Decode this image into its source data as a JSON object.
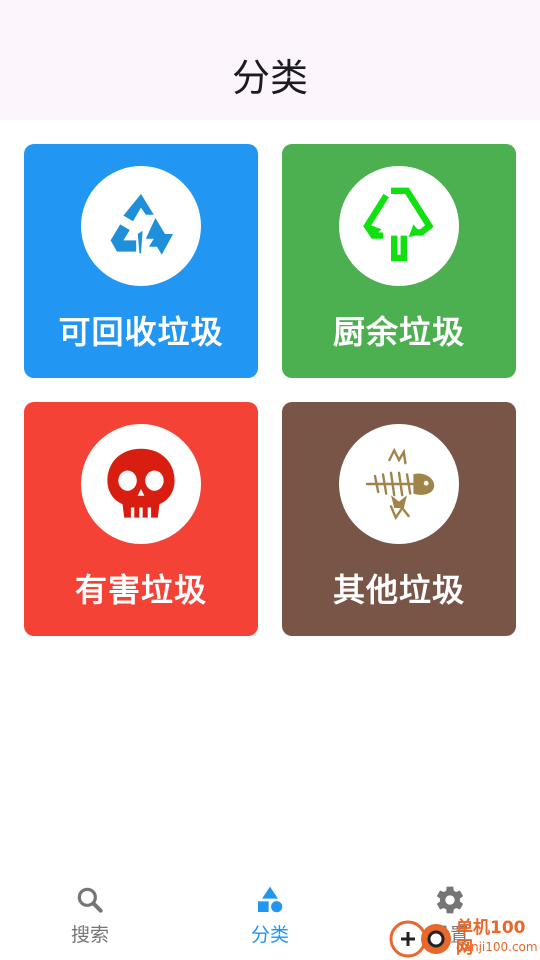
{
  "header": {
    "title": "分类"
  },
  "categories": [
    {
      "label": "可回收垃圾",
      "color": "#2196f3",
      "icon": "recycle-icon",
      "icon_color": "#1e8fd8"
    },
    {
      "label": "厨余垃圾",
      "color": "#4caf50",
      "icon": "kitchen-tree-icon",
      "icon_color": "#10e010"
    },
    {
      "label": "有害垃圾",
      "color": "#f44336",
      "icon": "skull-icon",
      "icon_color": "#d81e10"
    },
    {
      "label": "其他垃圾",
      "color": "#795548",
      "icon": "fish-bone-icon",
      "icon_color": "#a0844a"
    }
  ],
  "bottom_nav": {
    "items": [
      {
        "label": "搜索",
        "icon": "search-icon",
        "active": false
      },
      {
        "label": "分类",
        "icon": "shapes-icon",
        "active": true
      },
      {
        "label": "设置",
        "icon": "gear-icon",
        "active": false
      }
    ],
    "active_color": "#2196f3",
    "inactive_color": "#757575"
  },
  "watermark": {
    "brand": "单机100网",
    "url": "danji100.com"
  }
}
